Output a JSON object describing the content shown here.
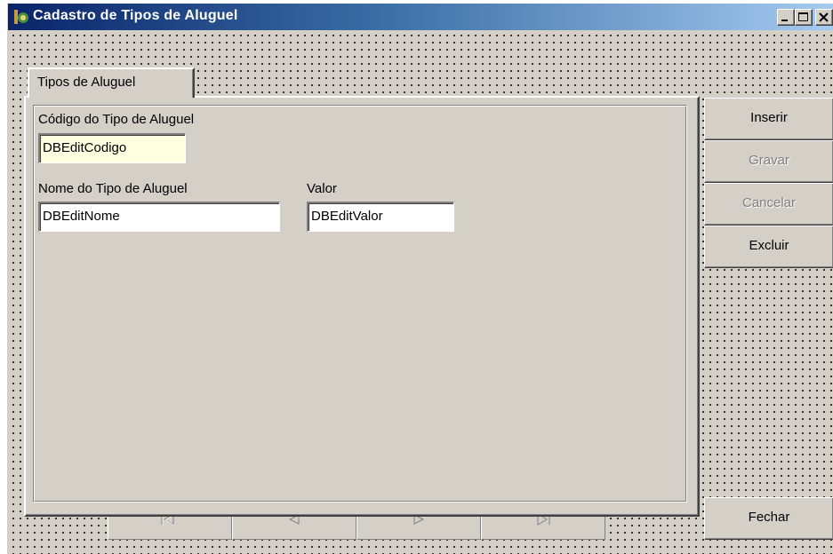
{
  "window": {
    "title": "Cadastro de Tipos de Aluguel"
  },
  "tab": {
    "label": "Tipos de Aluguel"
  },
  "form": {
    "codigo_label": "Código do Tipo de Aluguel",
    "codigo_value": "DBEditCodigo",
    "nome_label": "Nome do Tipo de Aluguel",
    "nome_value": "DBEditNome",
    "valor_label": "Valor",
    "valor_value": "DBEditValor"
  },
  "buttons": {
    "inserir": {
      "before": "",
      "key": "I",
      "after": "nserir"
    },
    "gravar": {
      "before": "",
      "key": "G",
      "after": "ravar"
    },
    "cancelar": {
      "before": "",
      "key": "C",
      "after": "ancelar"
    },
    "excluir": {
      "before": "",
      "key": "E",
      "after": "xcluir"
    },
    "fechar": "Fechar"
  },
  "navigator": [
    "first-icon",
    "prior-icon",
    "next-icon",
    "last-icon"
  ]
}
